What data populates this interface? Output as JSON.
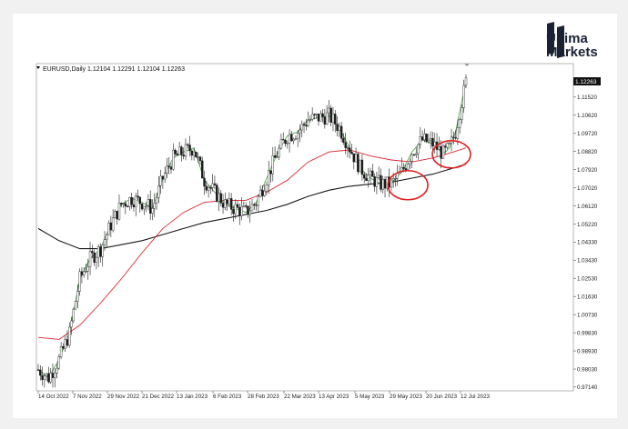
{
  "brand": {
    "line1": "Ultima",
    "line2": "Markets"
  },
  "chart_header": "EURUSD,Daily  1.12104 1.12291 1.12104 1.12263",
  "price_tag": "1.12263",
  "chart_data": {
    "type": "candlestick",
    "symbol": "EURUSD",
    "timeframe": "Daily",
    "ohlc_last": {
      "open": 1.12104,
      "high": 1.12291,
      "low": 1.12104,
      "close": 1.12263
    },
    "ylim": [
      0.9695,
      1.1318
    ],
    "y_ticks": [
      "1.11520",
      "1.10620",
      "1.09720",
      "1.08820",
      "1.07920",
      "1.07020",
      "1.06120",
      "1.05220",
      "1.04330",
      "1.03430",
      "1.02530",
      "1.01630",
      "1.00730",
      "0.99830",
      "0.98930",
      "0.98030",
      "0.97140"
    ],
    "x_ticks": [
      "14 Oct 2022",
      "7 Nov 2022",
      "29 Nov 2022",
      "21 Dec 2022",
      "13 Jan 2023",
      "6 Feb 2023",
      "28 Feb 2023",
      "22 Mar 2023",
      "13 Apr 2023",
      "5 May 2023",
      "29 May 2023",
      "20 Jun 2023",
      "12 Jul 2023"
    ],
    "close_path": [
      [
        0,
        0.98
      ],
      [
        5,
        0.976
      ],
      [
        10,
        0.985
      ],
      [
        15,
        0.998
      ],
      [
        20,
        1.025
      ],
      [
        25,
        1.035
      ],
      [
        30,
        1.04
      ],
      [
        35,
        1.052
      ],
      [
        40,
        1.062
      ],
      [
        45,
        1.065
      ],
      [
        50,
        1.063
      ],
      [
        55,
        1.06
      ],
      [
        60,
        1.075
      ],
      [
        65,
        1.085
      ],
      [
        70,
        1.088
      ],
      [
        75,
        1.09
      ],
      [
        80,
        1.074
      ],
      [
        85,
        1.068
      ],
      [
        90,
        1.062
      ],
      [
        95,
        1.06
      ],
      [
        100,
        1.058
      ],
      [
        105,
        1.063
      ],
      [
        110,
        1.075
      ],
      [
        115,
        1.087
      ],
      [
        120,
        1.096
      ],
      [
        125,
        1.098
      ],
      [
        130,
        1.104
      ],
      [
        135,
        1.105
      ],
      [
        140,
        1.106
      ],
      [
        145,
        1.1
      ],
      [
        150,
        1.09
      ],
      [
        155,
        1.08
      ],
      [
        160,
        1.075
      ],
      [
        165,
        1.072
      ],
      [
        170,
        1.072
      ],
      [
        175,
        1.078
      ],
      [
        180,
        1.088
      ],
      [
        185,
        1.094
      ],
      [
        190,
        1.092
      ],
      [
        195,
        1.087
      ],
      [
        198,
        1.09
      ],
      [
        201,
        1.098
      ],
      [
        204,
        1.113
      ],
      [
        206,
        1.1226
      ]
    ],
    "ma_red": [
      [
        0,
        0.996
      ],
      [
        10,
        0.995
      ],
      [
        20,
        1.002
      ],
      [
        30,
        1.013
      ],
      [
        40,
        1.025
      ],
      [
        50,
        1.038
      ],
      [
        60,
        1.05
      ],
      [
        70,
        1.058
      ],
      [
        80,
        1.063
      ],
      [
        90,
        1.064
      ],
      [
        100,
        1.064
      ],
      [
        110,
        1.068
      ],
      [
        120,
        1.074
      ],
      [
        130,
        1.083
      ],
      [
        140,
        1.088
      ],
      [
        150,
        1.089
      ],
      [
        160,
        1.086
      ],
      [
        170,
        1.084
      ],
      [
        180,
        1.083
      ],
      [
        190,
        1.085
      ],
      [
        200,
        1.088
      ],
      [
        206,
        1.09
      ]
    ],
    "ma_black": [
      [
        0,
        1.05
      ],
      [
        10,
        1.044
      ],
      [
        20,
        1.04
      ],
      [
        30,
        1.04
      ],
      [
        40,
        1.042
      ],
      [
        50,
        1.044
      ],
      [
        60,
        1.047
      ],
      [
        70,
        1.05
      ],
      [
        80,
        1.053
      ],
      [
        90,
        1.055
      ],
      [
        100,
        1.057
      ],
      [
        110,
        1.059
      ],
      [
        120,
        1.062
      ],
      [
        130,
        1.066
      ],
      [
        140,
        1.069
      ],
      [
        150,
        1.071
      ],
      [
        160,
        1.072
      ],
      [
        170,
        1.073
      ],
      [
        180,
        1.075
      ],
      [
        190,
        1.077
      ],
      [
        200,
        1.08
      ],
      [
        206,
        1.082
      ]
    ],
    "annotations": [
      {
        "shape": "ellipse",
        "color": "#e02020",
        "at_bar": 178,
        "at_price": 1.0715
      },
      {
        "shape": "ellipse",
        "color": "#e02020",
        "at_bar": 199,
        "at_price": 1.0868
      }
    ],
    "colors": {
      "ma_fast": "#e0262e",
      "ma_slow": "#1a1a1a",
      "up_line": "#3c9a3c",
      "candles": "#1a1a1a"
    }
  }
}
